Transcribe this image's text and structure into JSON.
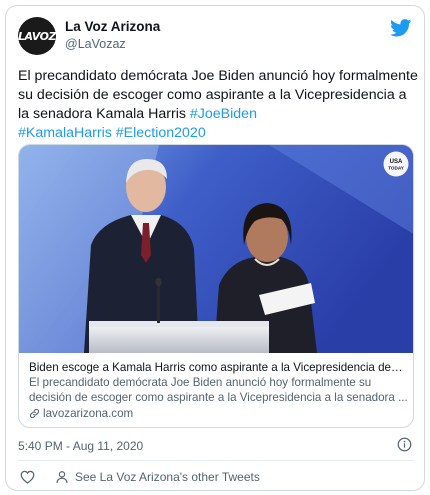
{
  "tweet": {
    "author": {
      "display_name": "La Voz Arizona",
      "handle": "@LaVozaz",
      "avatar_text": "LAVOZ"
    },
    "text_segments": [
      {
        "text": "El precandidato demócrata Joe Biden anunció hoy formalmente su decisión de escoger como aspirante a la Vicepresidencia a la senadora Kamala Harris ",
        "type": "text"
      },
      {
        "text": "#JoeBiden",
        "type": "hashtag"
      },
      {
        "text": " ",
        "type": "text"
      },
      {
        "text": "#KamalaHarris",
        "type": "hashtag"
      },
      {
        "text": " ",
        "type": "text"
      },
      {
        "text": "#Election2020",
        "type": "hashtag"
      }
    ],
    "timestamp": "5:40 PM - Aug 11, 2020"
  },
  "link_card": {
    "photo_badge": "USA TODAY",
    "title": "Biden escoge a Kamala Harris como aspirante a la Vicepresidencia demócrata",
    "description": "El precandidato demócrata Joe Biden anunció hoy formalmente su decisión de escoger como aspirante a la Vicepresidencia a la senadora ...",
    "domain": "lavozarizona.com"
  },
  "footer": {
    "other_tweets_text": "See La Voz Arizona's other Tweets"
  },
  "colors": {
    "accent": "#1d9bf0",
    "secondary_text": "#536471",
    "border": "#cfd9de"
  },
  "icons": [
    "twitter-bird-icon",
    "link-icon",
    "info-icon",
    "heart-icon",
    "person-icon"
  ]
}
